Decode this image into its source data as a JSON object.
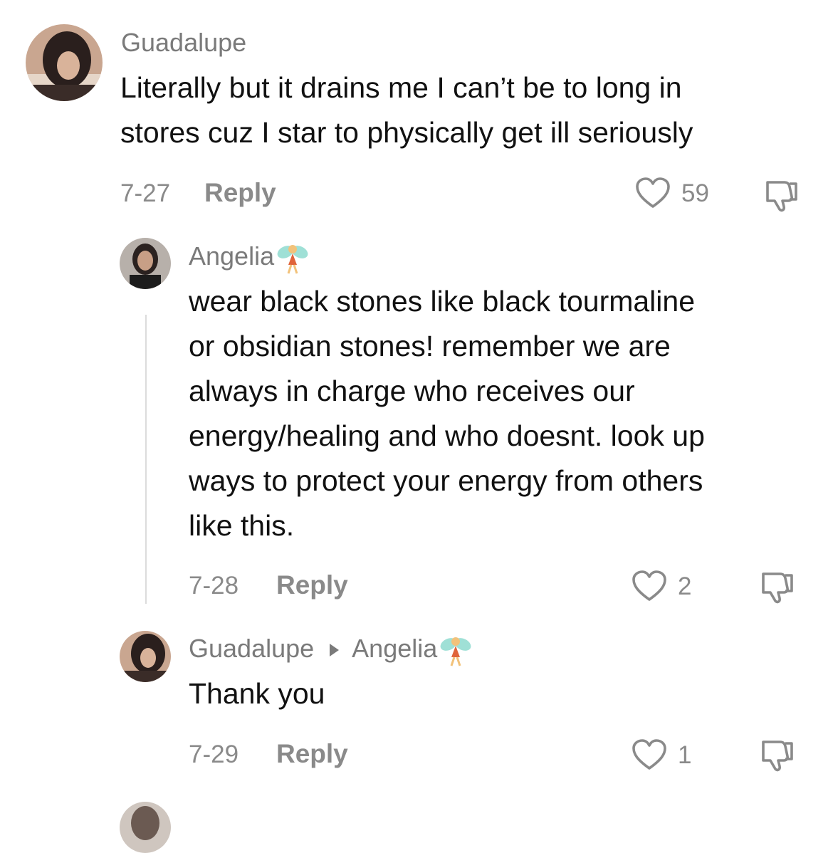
{
  "comments": {
    "c1": {
      "username": "Guadalupe",
      "lines": [
        "Literally but it drains me I can’t be to long in",
        "stores cuz I star to physically get ill seriously"
      ],
      "date": "7-27",
      "reply_label": "Reply",
      "likes": "59"
    },
    "c2": {
      "username": "Angelia",
      "lines": [
        "wear black stones like black tourmaline",
        "or obsidian stones! remember we are",
        "always in charge who receives our",
        "energy/healing and who doesnt. look up",
        "ways to protect your energy from others",
        "like this."
      ],
      "date": "7-28",
      "reply_label": "Reply",
      "likes": "2"
    },
    "c3": {
      "username": "Guadalupe",
      "reply_to": "Angelia",
      "lines": [
        "Thank you"
      ],
      "date": "7-29",
      "reply_label": "Reply",
      "likes": "1"
    }
  },
  "icons": {
    "like": "heart-outline-icon",
    "dislike": "thumbs-down-icon",
    "emoji": "fairy-emoji"
  },
  "colors": {
    "text": "#111111",
    "muted": "#8a8a8a",
    "username": "#7a7a7a",
    "thread_line": "#dcdcdc"
  }
}
